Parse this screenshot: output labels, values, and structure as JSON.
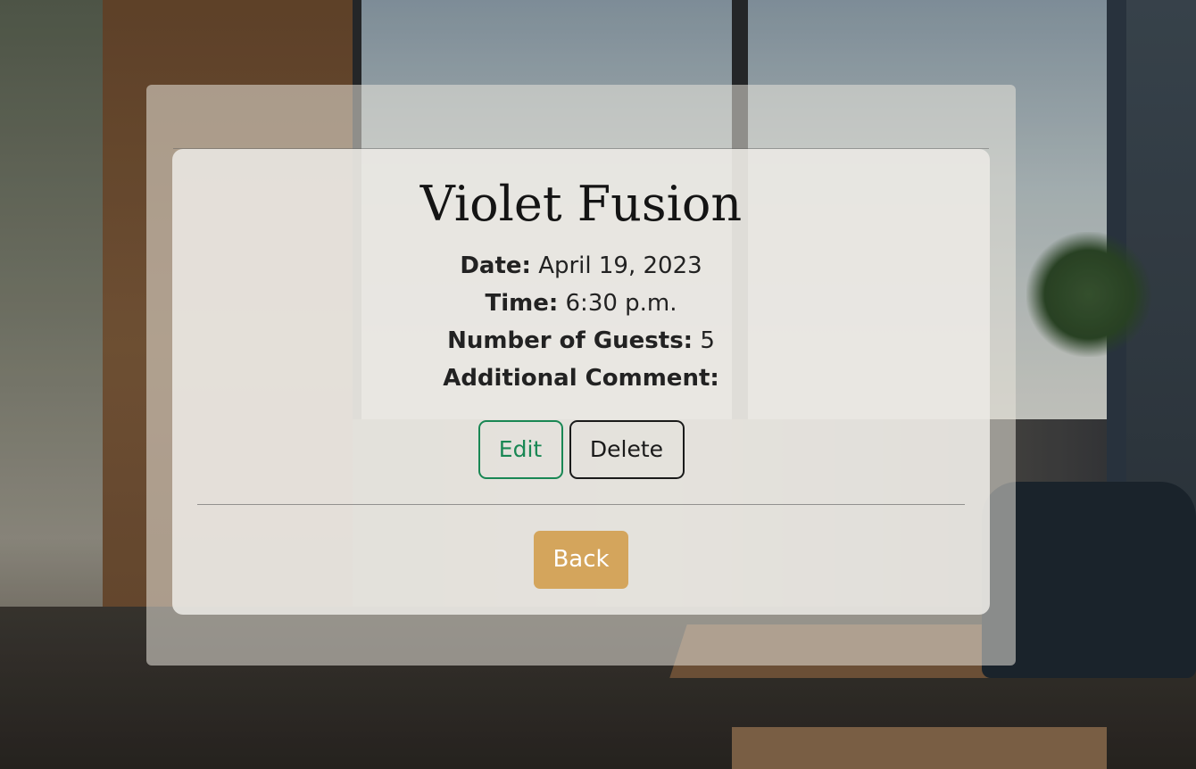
{
  "booking": {
    "title": "Violet Fusion",
    "fields": [
      {
        "label": "Date:",
        "value": "April 19, 2023"
      },
      {
        "label": "Time:",
        "value": "6:30 p.m."
      },
      {
        "label": "Number of Guests:",
        "value": "5"
      },
      {
        "label": "Additional Comment:",
        "value": ""
      }
    ]
  },
  "actions": {
    "edit_label": "Edit",
    "delete_label": "Delete",
    "back_label": "Back"
  },
  "colors": {
    "edit_accent": "#198754",
    "back_button": "#d4a55c"
  }
}
